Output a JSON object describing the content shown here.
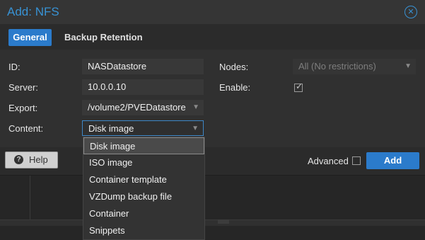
{
  "dialog": {
    "title": "Add: NFS"
  },
  "tabs": [
    {
      "label": "General"
    },
    {
      "label": "Backup Retention"
    }
  ],
  "form": {
    "id": {
      "label": "ID:",
      "value": "NASDatastore"
    },
    "server": {
      "label": "Server:",
      "value": "10.0.0.10"
    },
    "export": {
      "label": "Export:",
      "value": "/volume2/PVEDatastore"
    },
    "content": {
      "label": "Content:",
      "value": "Disk image"
    },
    "nodes": {
      "label": "Nodes:",
      "value": "All (No restrictions)"
    },
    "enable": {
      "label": "Enable:",
      "checked": true
    }
  },
  "footer": {
    "help_label": "Help",
    "advanced_label": "Advanced",
    "advanced_checked": false,
    "add_label": "Add"
  },
  "dropdown": {
    "options": [
      {
        "label": "Disk image",
        "selected": true
      },
      {
        "label": "ISO image"
      },
      {
        "label": "Container template"
      },
      {
        "label": "VZDump backup file"
      },
      {
        "label": "Container"
      },
      {
        "label": "Snippets"
      }
    ]
  },
  "colors": {
    "accent": "#2b7bcb",
    "title": "#3892d4",
    "background": "#2f2f2f"
  }
}
